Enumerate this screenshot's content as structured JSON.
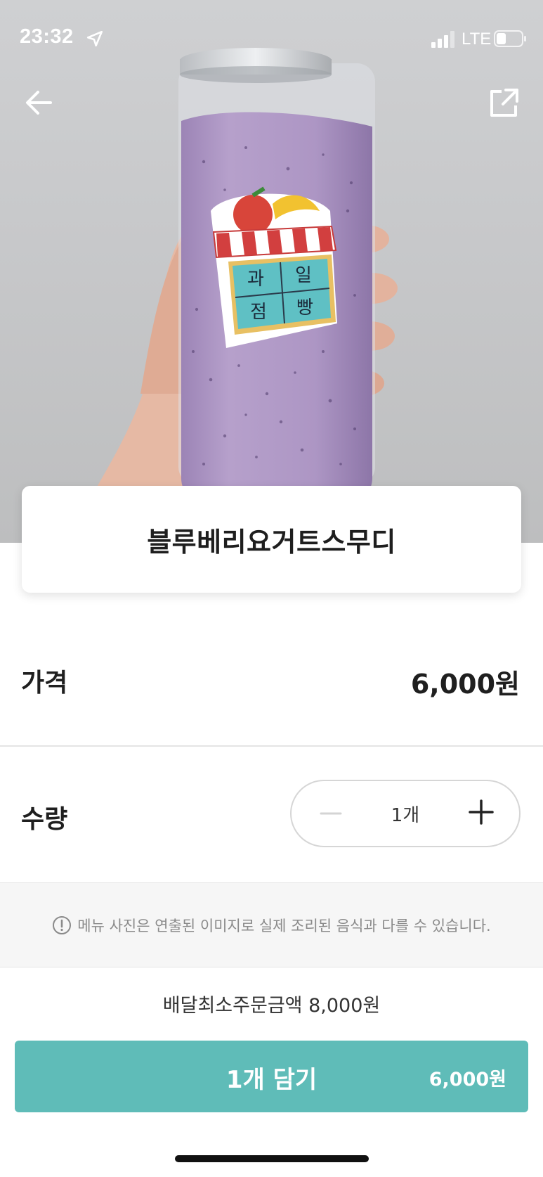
{
  "status_bar": {
    "time": "23:32",
    "network": "LTE",
    "icons": [
      "location-arrow-icon",
      "signal-bars-icon",
      "battery-icon"
    ]
  },
  "header": {
    "icons": [
      "back-arrow-icon",
      "share-icon"
    ]
  },
  "hero_image": {
    "sticker": {
      "glyphs": [
        "과",
        "일",
        "점",
        "빵"
      ]
    }
  },
  "product": {
    "name": "블루베리요거트스무디"
  },
  "price": {
    "label": "가격",
    "value": "6,000원"
  },
  "quantity": {
    "label": "수량",
    "value": "1개",
    "count": 1,
    "icons": [
      "minus-icon",
      "plus-icon"
    ]
  },
  "notice": {
    "icon": "info-circle-icon",
    "text": "메뉴 사진은 연출된 이미지로 실제 조리된 음식과 다를 수 있습니다."
  },
  "footer": {
    "min_order": "배달최소주문금액 8,000원",
    "cart_button_label": "1개 담기",
    "cart_button_price": "6,000원"
  },
  "colors": {
    "accent": "#5fbcb8",
    "smoothie": "#a992c2",
    "sticker_panel": "#5fc0c4"
  }
}
